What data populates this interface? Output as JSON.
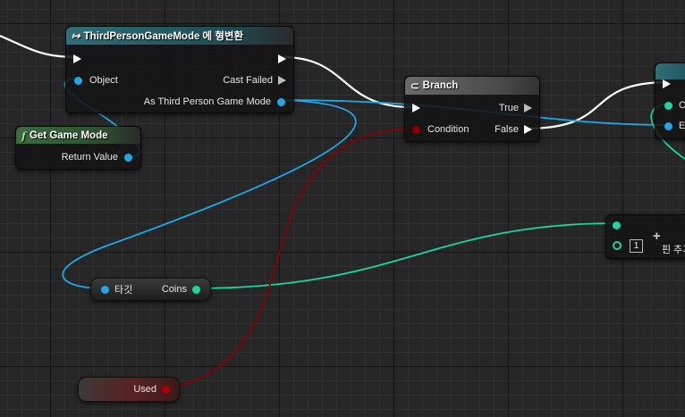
{
  "cast_node": {
    "title": "ThirdPersonGameMode 에 형변환",
    "pin_object": "Object",
    "pin_cast_failed": "Cast Failed",
    "pin_as": "As Third Person Game Mode",
    "icon": "cast-arrow-icon"
  },
  "get_game_mode": {
    "title": "Get Game Mode",
    "icon_glyph": "f",
    "pin_return": "Return Value"
  },
  "branch": {
    "title": "Branch",
    "pin_true": "True",
    "pin_condition": "Condition",
    "pin_false": "False",
    "icon": "branch-icon"
  },
  "target_node": {
    "pin_target": "타깃",
    "pin_coins": "Coins"
  },
  "used_node": {
    "pin_used": "Used"
  },
  "array_node": {
    "index": "1",
    "add_pin": "+",
    "add_label": "핀 추가"
  },
  "right_node": {
    "pin_c": "C",
    "pin_e": "E"
  },
  "colors": {
    "object_pin": "#1fa8e8",
    "bool_pin": "#8a0000",
    "int_pin": "#1ad6a0",
    "exec": "#ffffff",
    "cast_header": "#2f6f7a",
    "func_header": "#3c6b3e",
    "branch_header": "#5b5b5b"
  }
}
